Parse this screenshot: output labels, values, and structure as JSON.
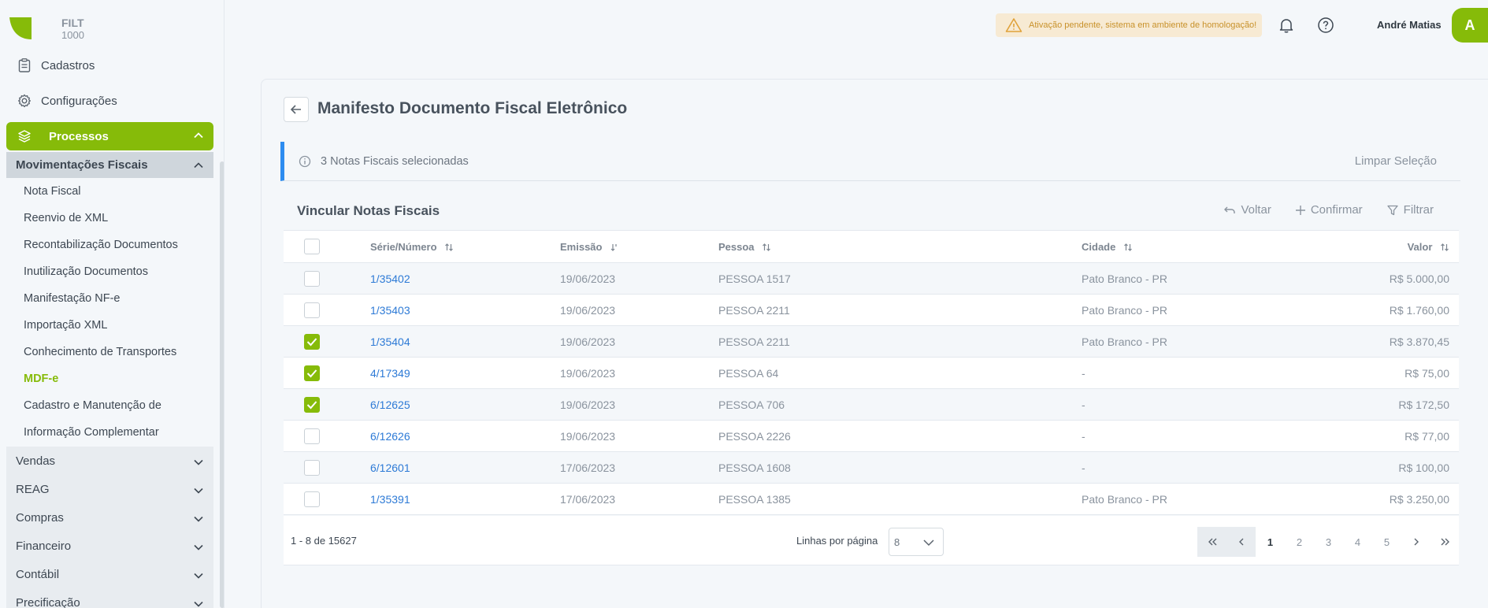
{
  "brand": {
    "name": "FILT",
    "number": "1000"
  },
  "sidebar": {
    "cadastros": "Cadastros",
    "configuracoes": "Configurações",
    "processos": "Processos",
    "movimentacoes": "Movimentações Fiscais",
    "sub_items": [
      "Nota Fiscal",
      "Reenvio de XML",
      "Recontabilização Documentos",
      "Inutilização Documentos",
      "Manifestação NF-e",
      "Importação XML",
      "Conhecimento de Transportes",
      "MDF-e",
      "Cadastro e Manutenção de",
      "Informação Complementar"
    ],
    "groups": [
      "Vendas",
      "REAG",
      "Compras",
      "Financeiro",
      "Contábil",
      "Precificação"
    ]
  },
  "topbar": {
    "alert": "Ativação pendente, sistema em ambiente de homologação!",
    "user": "André Matias",
    "avatar": "A"
  },
  "page": {
    "title": "Manifesto Documento Fiscal Eletrônico",
    "selection": "3 Notas Fiscais selecionadas",
    "clear_selection": "Limpar Seleção"
  },
  "table": {
    "title": "Vincular Notas Fiscais",
    "actions": {
      "voltar": "Voltar",
      "confirmar": "Confirmar",
      "filtrar": "Filtrar"
    },
    "headers": {
      "serie": "Série/Número",
      "emissao": "Emissão",
      "pessoa": "Pessoa",
      "cidade": "Cidade",
      "valor": "Valor"
    },
    "rows": [
      {
        "checked": false,
        "serie": "1/35402",
        "emissao": "19/06/2023",
        "pessoa": "PESSOA 1517",
        "cidade": "Pato Branco - PR",
        "valor": "R$ 5.000,00"
      },
      {
        "checked": false,
        "serie": "1/35403",
        "emissao": "19/06/2023",
        "pessoa": "PESSOA 2211",
        "cidade": "Pato Branco - PR",
        "valor": "R$ 1.760,00"
      },
      {
        "checked": true,
        "serie": "1/35404",
        "emissao": "19/06/2023",
        "pessoa": "PESSOA 2211",
        "cidade": "Pato Branco - PR",
        "valor": "R$ 3.870,45"
      },
      {
        "checked": true,
        "serie": "4/17349",
        "emissao": "19/06/2023",
        "pessoa": "PESSOA 64",
        "cidade": "-",
        "valor": "R$ 75,00"
      },
      {
        "checked": true,
        "serie": "6/12625",
        "emissao": "19/06/2023",
        "pessoa": "PESSOA 706",
        "cidade": "-",
        "valor": "R$ 172,50"
      },
      {
        "checked": false,
        "serie": "6/12626",
        "emissao": "19/06/2023",
        "pessoa": "PESSOA 2226",
        "cidade": "-",
        "valor": "R$ 77,00"
      },
      {
        "checked": false,
        "serie": "6/12601",
        "emissao": "17/06/2023",
        "pessoa": "PESSOA 1608",
        "cidade": "-",
        "valor": "R$ 100,00"
      },
      {
        "checked": false,
        "serie": "1/35391",
        "emissao": "17/06/2023",
        "pessoa": "PESSOA 1385",
        "cidade": "Pato Branco - PR",
        "valor": "R$ 3.250,00"
      }
    ]
  },
  "footer": {
    "count": "1 - 8 de 15627",
    "rows_label": "Linhas por página",
    "rows_value": "8",
    "pages": [
      "1",
      "2",
      "3",
      "4",
      "5"
    ],
    "current_page": "1"
  },
  "colors": {
    "accent": "#86bb09",
    "link": "#2d7ad6",
    "info": "#2d8cf0",
    "warning_bg": "#f7ead3"
  }
}
